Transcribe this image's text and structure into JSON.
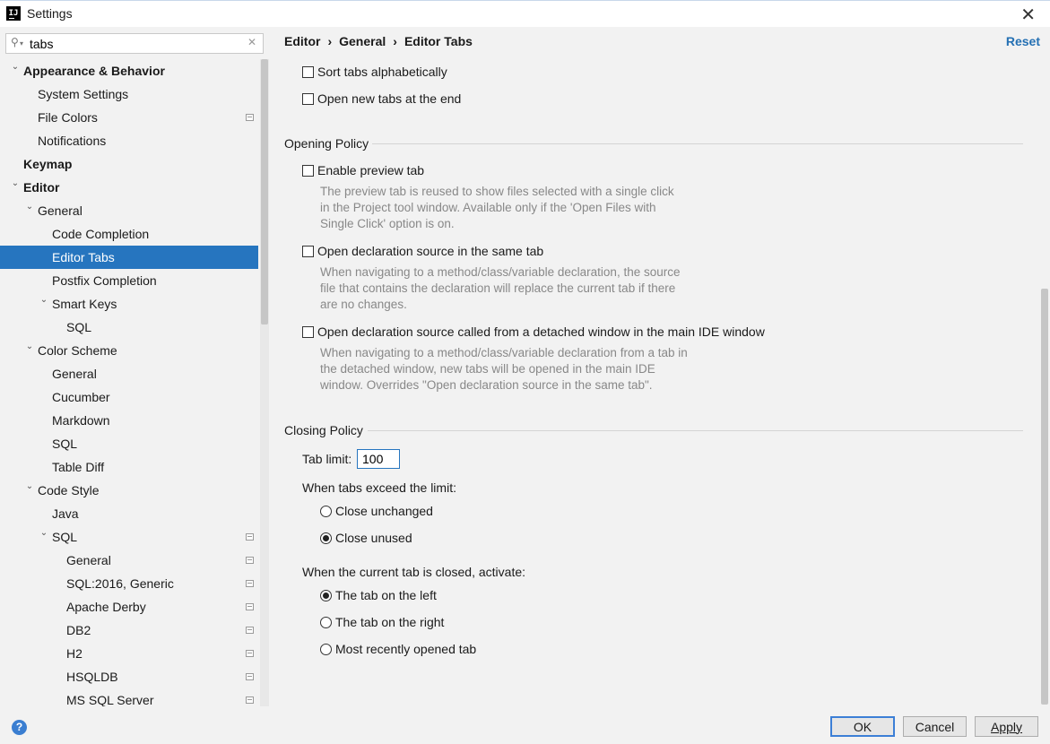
{
  "window": {
    "title": "Settings",
    "app_icon_text": "IJ"
  },
  "search": {
    "value": "tabs"
  },
  "tree": [
    {
      "label": "Appearance & Behavior",
      "depth": 0,
      "arrow": "down",
      "bold": true
    },
    {
      "label": "System Settings",
      "depth": 1
    },
    {
      "label": "File Colors",
      "depth": 1,
      "project": true
    },
    {
      "label": "Notifications",
      "depth": 1
    },
    {
      "label": "Keymap",
      "depth": 0,
      "bold": true
    },
    {
      "label": "Editor",
      "depth": 0,
      "arrow": "down",
      "bold": true
    },
    {
      "label": "General",
      "depth": 1,
      "arrow": "down"
    },
    {
      "label": "Code Completion",
      "depth": 2
    },
    {
      "label": "Editor Tabs",
      "depth": 2,
      "selected": true
    },
    {
      "label": "Postfix Completion",
      "depth": 2
    },
    {
      "label": "Smart Keys",
      "depth": 2,
      "arrow": "down"
    },
    {
      "label": "SQL",
      "depth": 3
    },
    {
      "label": "Color Scheme",
      "depth": 1,
      "arrow": "down"
    },
    {
      "label": "General",
      "depth": 2
    },
    {
      "label": "Cucumber",
      "depth": 2
    },
    {
      "label": "Markdown",
      "depth": 2
    },
    {
      "label": "SQL",
      "depth": 2
    },
    {
      "label": "Table Diff",
      "depth": 2
    },
    {
      "label": "Code Style",
      "depth": 1,
      "arrow": "down"
    },
    {
      "label": "Java",
      "depth": 2
    },
    {
      "label": "SQL",
      "depth": 2,
      "arrow": "down",
      "project": true
    },
    {
      "label": "General",
      "depth": 3,
      "project": true
    },
    {
      "label": "SQL:2016, Generic",
      "depth": 3,
      "project": true
    },
    {
      "label": "Apache Derby",
      "depth": 3,
      "project": true
    },
    {
      "label": "DB2",
      "depth": 3,
      "project": true
    },
    {
      "label": "H2",
      "depth": 3,
      "project": true
    },
    {
      "label": "HSQLDB",
      "depth": 3,
      "project": true
    },
    {
      "label": "MS SQL Server",
      "depth": 3,
      "project": true
    }
  ],
  "breadcrumb": {
    "items": [
      "Editor",
      "General",
      "Editor Tabs"
    ],
    "separator": "›"
  },
  "reset_label": "Reset",
  "top_options": {
    "sort_tabs": {
      "label": "Sort tabs alphabetically",
      "checked": false
    },
    "open_new_at_end": {
      "label": "Open new tabs at the end",
      "checked": false
    }
  },
  "opening_policy": {
    "title": "Opening Policy",
    "preview_tab": {
      "label": "Enable preview tab",
      "checked": false,
      "desc": "The preview tab is reused to show files selected with a single click\nin the Project tool window. Available only if the 'Open Files with\nSingle Click' option is on."
    },
    "same_tab": {
      "label": "Open declaration source in the same tab",
      "checked": false,
      "desc": "When navigating to a method/class/variable declaration, the source\nfile that contains the declaration will replace the current tab if there\nare no changes."
    },
    "detached": {
      "label": "Open declaration source called from a detached window in the main IDE window",
      "checked": false,
      "desc": "When navigating to a method/class/variable declaration from a tab in\nthe detached window, new tabs will be opened in the main IDE\nwindow. Overrides \"Open declaration source in the same tab\"."
    }
  },
  "closing_policy": {
    "title": "Closing Policy",
    "tab_limit_label": "Tab limit:",
    "tab_limit_value": "100",
    "exceed_label": "When tabs exceed the limit:",
    "exceed_options": [
      {
        "label": "Close unchanged",
        "selected": false
      },
      {
        "label": "Close unused",
        "selected": true
      }
    ],
    "activate_label": "When the current tab is closed, activate:",
    "activate_options": [
      {
        "label": "The tab on the left",
        "selected": true
      },
      {
        "label": "The tab on the right",
        "selected": false
      },
      {
        "label": "Most recently opened tab",
        "selected": false
      }
    ]
  },
  "buttons": {
    "ok": "OK",
    "cancel": "Cancel",
    "apply": "Apply"
  },
  "colors": {
    "selection": "#2675bf",
    "link": "#2470b3",
    "description": "#888888"
  }
}
